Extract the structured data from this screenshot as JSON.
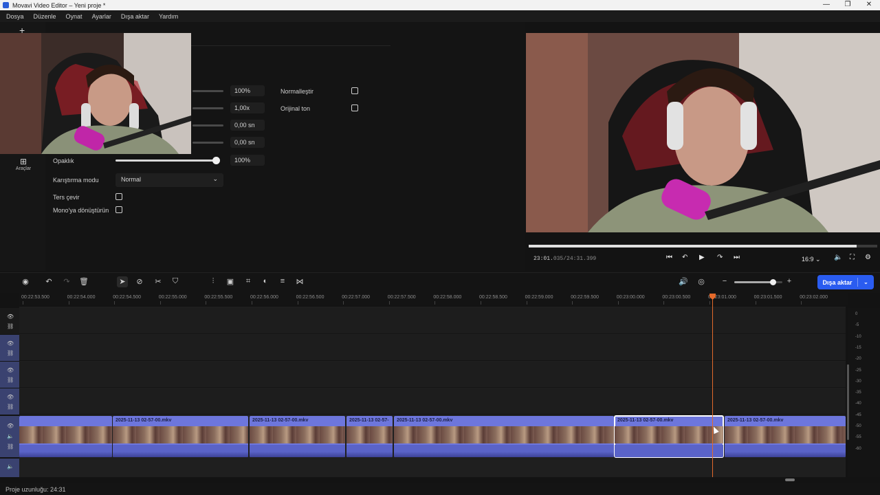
{
  "window": {
    "title": "Movavi Video Editor – Yeni proje *",
    "minimize": "—",
    "maximize": "❐",
    "close": "✕"
  },
  "menu": [
    "Dosya",
    "Düzenle",
    "Oynat",
    "Ayarlar",
    "Dışa aktar",
    "Yardım"
  ],
  "sidebar": {
    "tools_label": "Araçlar",
    "tools_icon": "grid-icon",
    "add_icon": "plus-icon"
  },
  "properties": {
    "rows": [
      {
        "value": "100%"
      },
      {
        "value": "1,00x"
      },
      {
        "value": "0,00 sn"
      },
      {
        "value": "0,00 sn"
      }
    ],
    "opacity": {
      "label": "Opaklık",
      "value": "100%",
      "level": 1.0
    },
    "blend_mode": {
      "label": "Karıştırma modu",
      "value": "Normal"
    },
    "reverse": {
      "label": "Ters çevir",
      "checked": false
    },
    "mono": {
      "label": "Mono'ya dönüştürün",
      "checked": false
    },
    "normalize": {
      "label": "Normalleştir",
      "checked": false
    },
    "original_tone": {
      "label": "Orijinal ton",
      "checked": false
    }
  },
  "player": {
    "timecode_current": "23:01.",
    "timecode_rest": "035/24:31.399",
    "progress": 0.94,
    "ratio": "16:9"
  },
  "timeline": {
    "export_label": "Dışa aktar",
    "ruler_ticks": [
      "00:22:53.500",
      "00:22:54.000",
      "00:22:54.500",
      "00:22:55.000",
      "00:22:55.500",
      "00:22:56.000",
      "00:22:56.500",
      "00:22:57.000",
      "00:22:57.500",
      "00:22:58.000",
      "00:22:58.500",
      "00:22:59.000",
      "00:22:59.500",
      "00:23:00.000",
      "00:23:00.500",
      "00:23:01.000",
      "00:23:01.500",
      "00:23:02.000"
    ],
    "clips": [
      {
        "name": ""
      },
      {
        "name": "2025-11-13 02-57-00.mkv"
      },
      {
        "name": "2025-11-13 02-57-00.mkv"
      },
      {
        "name": "2025-11-13 02-57-"
      },
      {
        "name": "2025-11-13 02-57-00.mkv"
      },
      {
        "name": "2025-11-13 02-57-00.mkv"
      },
      {
        "name": "2025-11-13 02-57-00.mkv"
      }
    ],
    "vu_labels": [
      "0",
      "-5",
      "-10",
      "-15",
      "-20",
      "-25",
      "-30",
      "-35",
      "-40",
      "-45",
      "-50",
      "-55",
      "-60"
    ]
  },
  "status": {
    "duration": "Proje uzunluğu: 24:31"
  }
}
